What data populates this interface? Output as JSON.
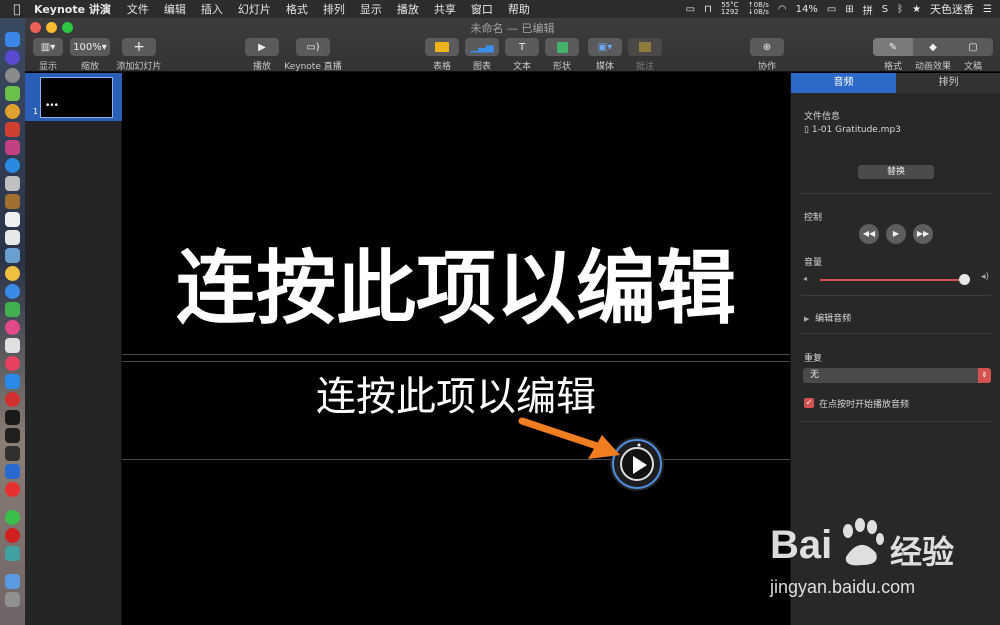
{
  "menubar": {
    "app_name": "Keynote 讲演",
    "menus": [
      "文件",
      "编辑",
      "插入",
      "幻灯片",
      "格式",
      "排列",
      "显示",
      "播放",
      "共享",
      "窗口",
      "帮助"
    ],
    "temp": "55°C",
    "fan": "1292",
    "net_up": "0B/s",
    "net_down": "0B/s",
    "battery": "14%",
    "user_name": "天色迷香"
  },
  "window": {
    "title": "未命名 — 已编辑"
  },
  "toolbar": {
    "view_label": "显示",
    "zoom_value": "100%",
    "zoom_label": "缩放",
    "add_slide_label": "添加幻灯片",
    "play_label": "播放",
    "keynote_live_label": "Keynote 直播",
    "table_label": "表格",
    "chart_label": "图表",
    "text_label": "文本",
    "shape_label": "形状",
    "media_label": "媒体",
    "comment_label": "批注",
    "collaborate_label": "协作",
    "format_label": "格式",
    "animate_label": "动画效果",
    "document_label": "文稿"
  },
  "navigator": {
    "slide_number": "1",
    "dots": "•••"
  },
  "slide": {
    "title": "连按此项以编辑",
    "subtitle": "连按此项以编辑"
  },
  "inspector": {
    "tab_audio": "音频",
    "tab_arrange": "排列",
    "file_info_label": "文件信息",
    "file_name": "1-01 Gratitude.mp3",
    "replace_button": "替换",
    "controls_label": "控制",
    "volume_label": "音量",
    "edit_audio_label": "编辑音频",
    "repeat_label": "重复",
    "repeat_value": "无",
    "start_on_click_label": "在点按时开始播放音频",
    "start_on_click_checked": true,
    "volume_level": 0.97
  },
  "watermark": {
    "brand": "Bai",
    "brand_cn": "经验",
    "url": "jingyan.baidu.com"
  }
}
